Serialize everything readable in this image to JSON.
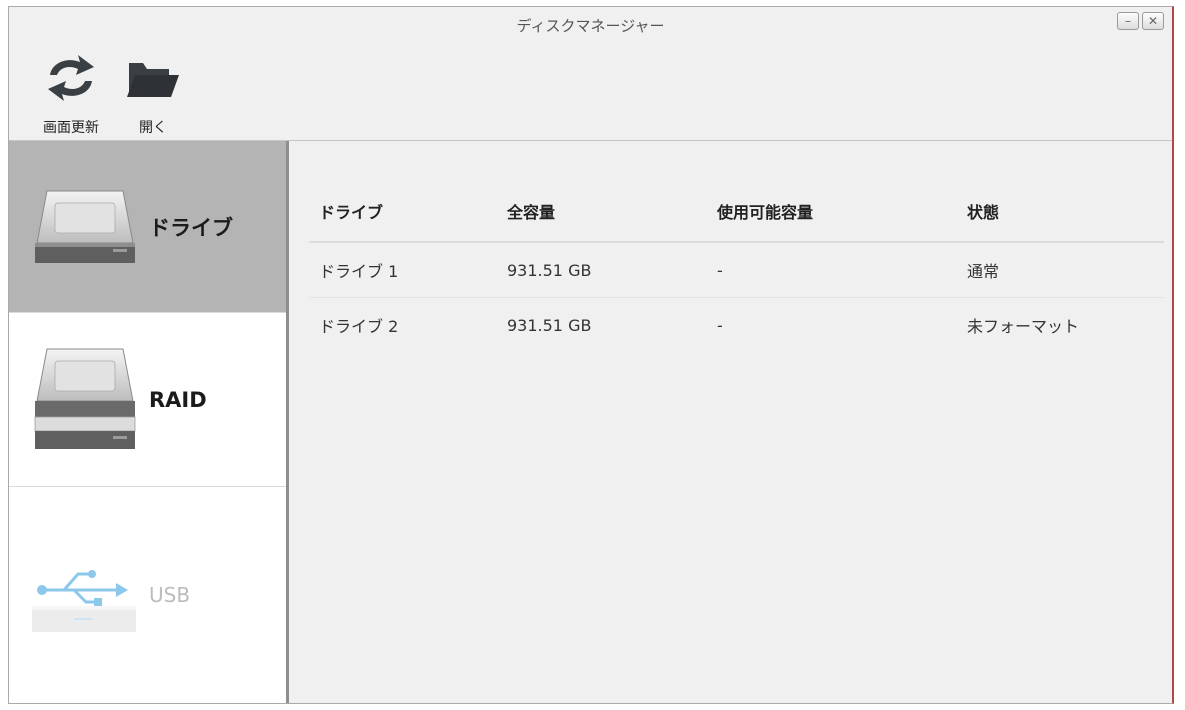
{
  "window": {
    "title": "ディスクマネージャー",
    "minimize_glyph": "–",
    "close_glyph": "✕"
  },
  "toolbar": {
    "refresh": {
      "label": "画面更新",
      "icon": "refresh-icon"
    },
    "open": {
      "label": "開く",
      "icon": "folder-icon"
    }
  },
  "sidebar": {
    "items": [
      {
        "label": "ドライブ",
        "icon": "hard-drive-icon",
        "selected": true
      },
      {
        "label": "RAID",
        "icon": "raid-drives-icon",
        "selected": false
      },
      {
        "label": "USB",
        "icon": "usb-icon",
        "selected": false,
        "disabled": true
      }
    ]
  },
  "table": {
    "headers": [
      "ドライブ",
      "全容量",
      "使用可能容量",
      "状態"
    ],
    "rows": [
      [
        "ドライブ 1",
        "931.51 GB",
        "-",
        "通常"
      ],
      [
        "ドライブ 2",
        "931.51 GB",
        "-",
        "未フォーマット"
      ]
    ]
  },
  "colors": {
    "selected_nav_bg": "#b4b4b4",
    "content_bg": "#f0f0f0",
    "usb_icon": "#7fbfe8"
  }
}
